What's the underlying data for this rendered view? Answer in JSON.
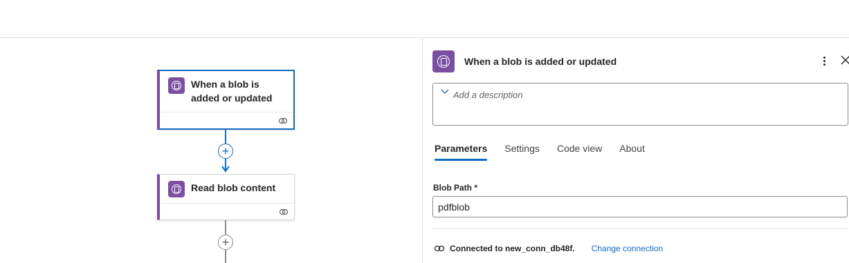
{
  "designer": {
    "nodes": [
      {
        "title": "When a blob is added or updated",
        "selected": true
      },
      {
        "title": "Read blob content",
        "selected": false
      }
    ]
  },
  "panel": {
    "title": "When a blob is added or updated",
    "description_placeholder": "Add a description",
    "tabs": [
      "Parameters",
      "Settings",
      "Code view",
      "About"
    ],
    "active_tab": "Parameters",
    "fields": {
      "blob_path_label": "Blob Path *",
      "blob_path_value": "pdfblob"
    },
    "connection": {
      "text": "Connected to new_conn_db48f.",
      "change_label": "Change connection"
    }
  },
  "colors": {
    "accent": "#0f6cbd",
    "connector_purple": "#7b4fa0",
    "border": "#e1e1e1"
  },
  "icons": {
    "node_icon": "blob-storage-icon",
    "menu": "more-vertical-icon",
    "close": "close-icon",
    "chevron": "chevron-down-icon",
    "link": "link-icon",
    "connection": "plug-icon"
  }
}
